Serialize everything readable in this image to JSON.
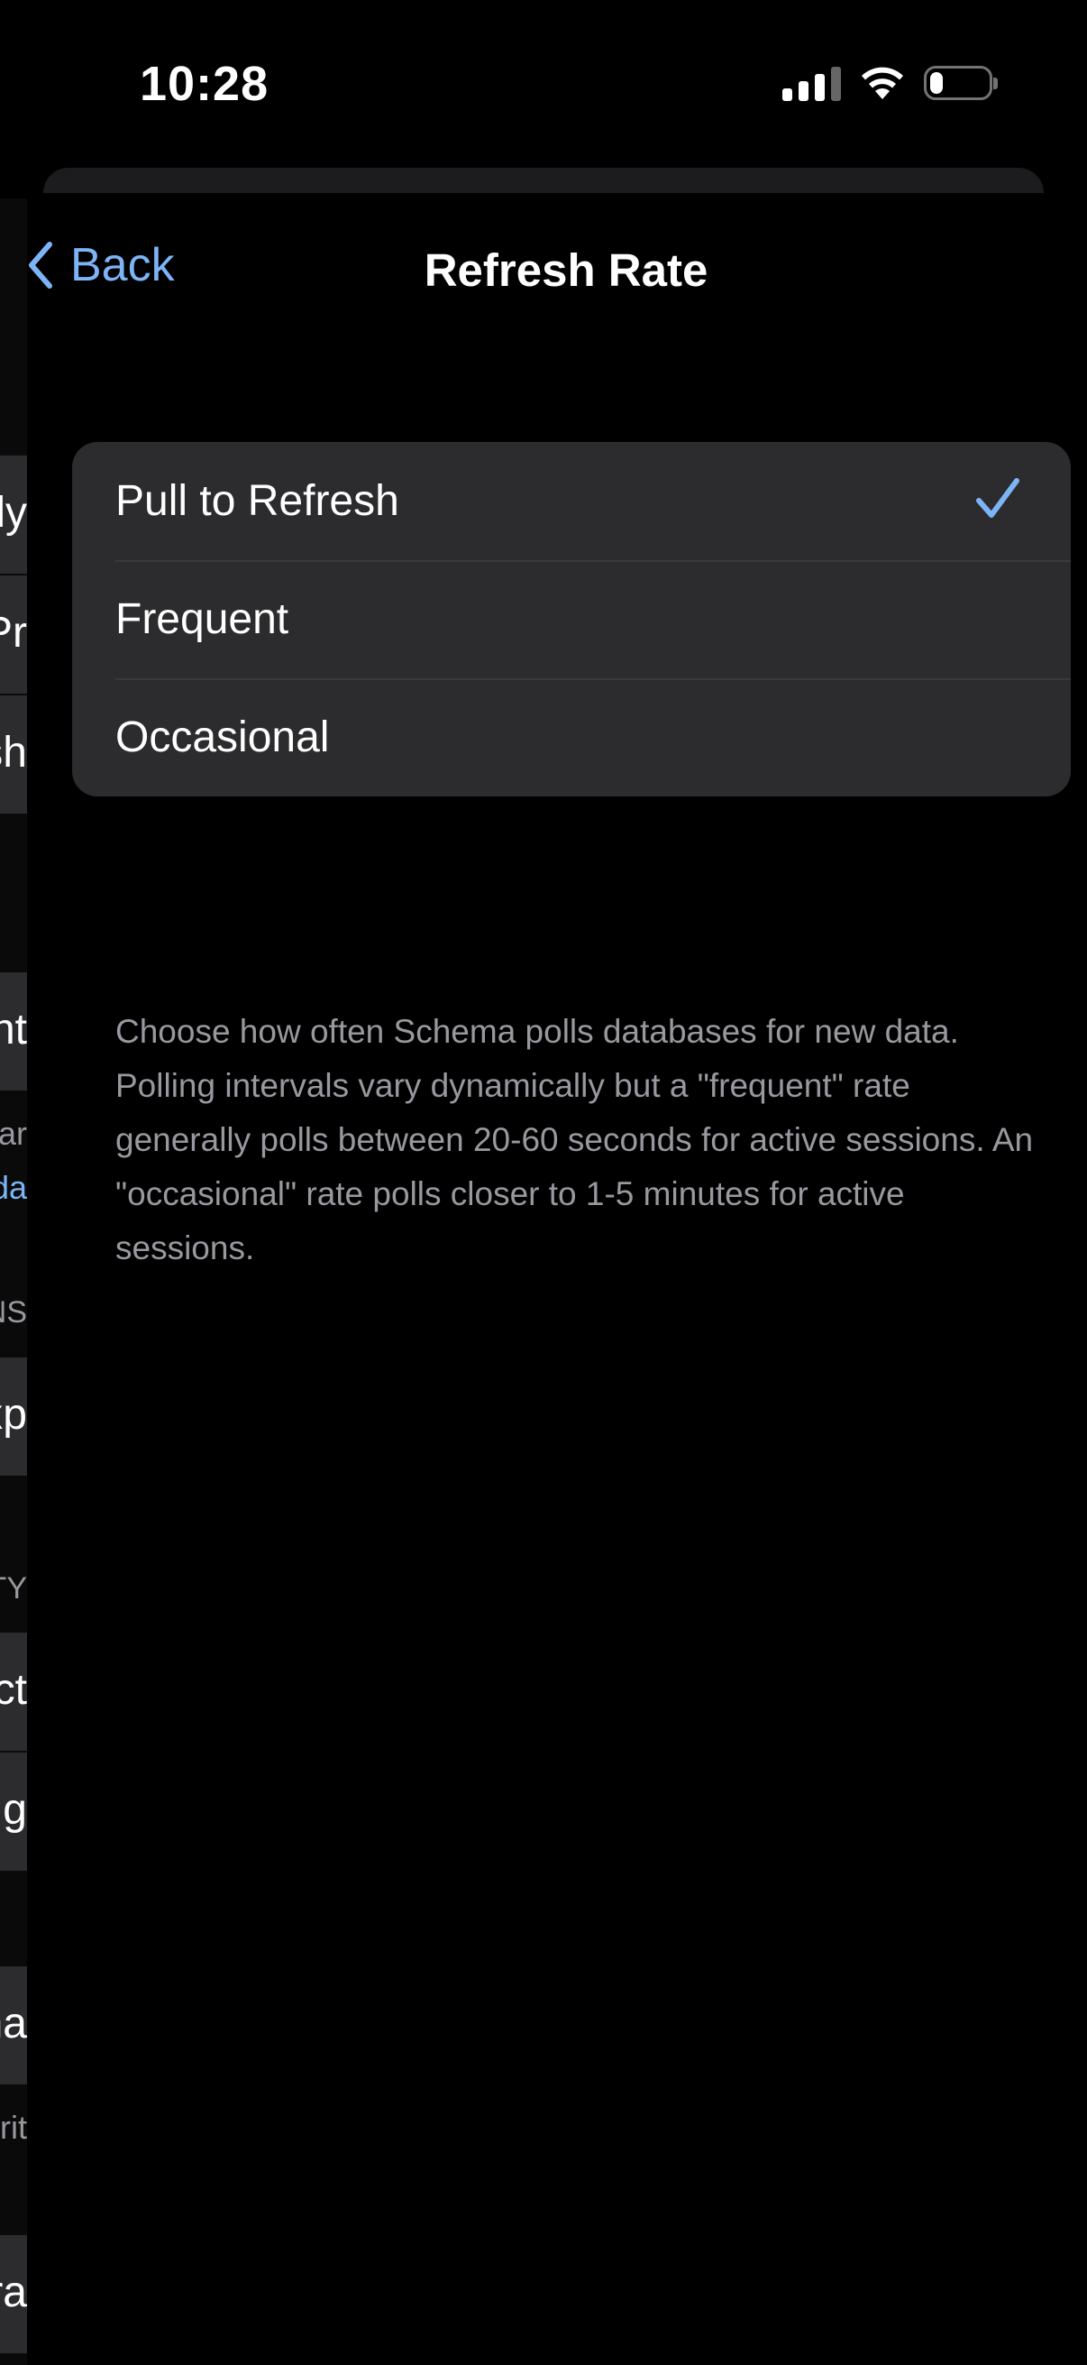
{
  "status_bar": {
    "time": "10:28",
    "icons": [
      "cellular-signal-icon",
      "wifi-icon",
      "battery-icon"
    ],
    "battery_level": 0.22
  },
  "background_sheet": {
    "partial_cells": [
      {
        "text": "ly"
      },
      {
        "text": "Pr"
      },
      {
        "text": "sh"
      },
      {
        "text": "nt"
      },
      {
        "text": "ar"
      },
      {
        "text": "da"
      },
      {
        "text": "NS"
      },
      {
        "text": "xp"
      },
      {
        "text": "TY"
      },
      {
        "text": "ct"
      },
      {
        "text": "g"
      },
      {
        "text": "na"
      },
      {
        "text": "rit"
      },
      {
        "text": "ra"
      }
    ]
  },
  "nav": {
    "back_label": "Back",
    "title": "Refresh Rate"
  },
  "options": [
    {
      "label": "Pull to Refresh",
      "selected": true
    },
    {
      "label": "Frequent",
      "selected": false
    },
    {
      "label": "Occasional",
      "selected": false
    }
  ],
  "footer_note": "Choose how often Schema polls databases for new data. Polling intervals vary dynamically but a \"frequent\" rate generally polls between 20-60 seconds for active sessions. An \"occasional\" rate polls closer to 1-5 minutes for active sessions.",
  "colors": {
    "accent": "#7db4f6",
    "grouped_background": "#2c2c2e",
    "secondary_text": "#98989f"
  }
}
